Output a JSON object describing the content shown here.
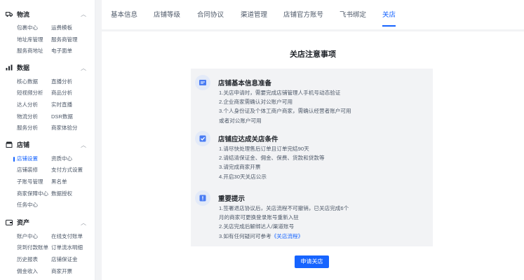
{
  "sidebar": {
    "groups": [
      {
        "title": "物流",
        "icon": "truck-icon",
        "items": [
          "包裹中心",
          "运费模板",
          "地址库管理",
          "服务商管理",
          "服务商地址",
          "电子面单"
        ]
      },
      {
        "title": "数据",
        "icon": "chart-icon",
        "items": [
          "核心数据",
          "直播分析",
          "短视频分析",
          "商品分析",
          "达人分析",
          "实时直播",
          "物流分析",
          "DSR数据",
          "服务分析",
          "商家体验分"
        ]
      },
      {
        "title": "店铺",
        "icon": "store-icon",
        "items": [
          "店铺设置",
          "资质中心",
          "店铺装修",
          "支付方式设置",
          "子账号管理",
          "黑名单",
          "商家保障中心",
          "数据授权",
          "任务中心"
        ]
      },
      {
        "title": "资产",
        "icon": "wallet-icon",
        "items": [
          "账户中心",
          "在线支付账单",
          "货到付款账单",
          "订单流水明细",
          "历史报表",
          "店铺保证金",
          "佣金收入",
          "商家开票"
        ]
      }
    ],
    "active_item": "店铺设置"
  },
  "tabs": [
    "基本信息",
    "店铺等级",
    "合同协议",
    "渠道管理",
    "店铺官方账号",
    "飞书绑定",
    "关店"
  ],
  "active_tab": "关店",
  "page": {
    "title": "关店注意事项",
    "sections": [
      {
        "title": "店铺基本信息准备",
        "icon": "document-icon",
        "lines": [
          "1.关店申请时，需要完成店铺管理人手机号动态验证",
          "2.企业商家需确认对公账户可用",
          "3.个人身份证及个体工商户商家，需确认经营者账户可用",
          "或者对公账户可用"
        ]
      },
      {
        "title": "店铺应达成关店条件",
        "icon": "checklist-icon",
        "lines": [
          "1.请尽快处理售后订单且订单完结90天",
          "2.请结清保证金、佣金、保费、货款和贷款等",
          "3.请完成商家开票",
          "4.开启30天关店公示"
        ]
      },
      {
        "title": "重要提示",
        "icon": "alert-icon",
        "lines": [
          "1.签署退店协议后，关店流程不可撤销，已关店完成6个",
          "月的商家可更换登录账号重新入驻",
          "2.关店完成后解绑达人/渠道账号",
          "3.如有任何疑问可参考"
        ],
        "link": "《关店流程》"
      }
    ],
    "apply_button": "申请关店"
  },
  "colors": {
    "accent": "#1664ff",
    "panel": "#f2f3f5",
    "text": "#1f2329",
    "muted": "#4e5969"
  }
}
